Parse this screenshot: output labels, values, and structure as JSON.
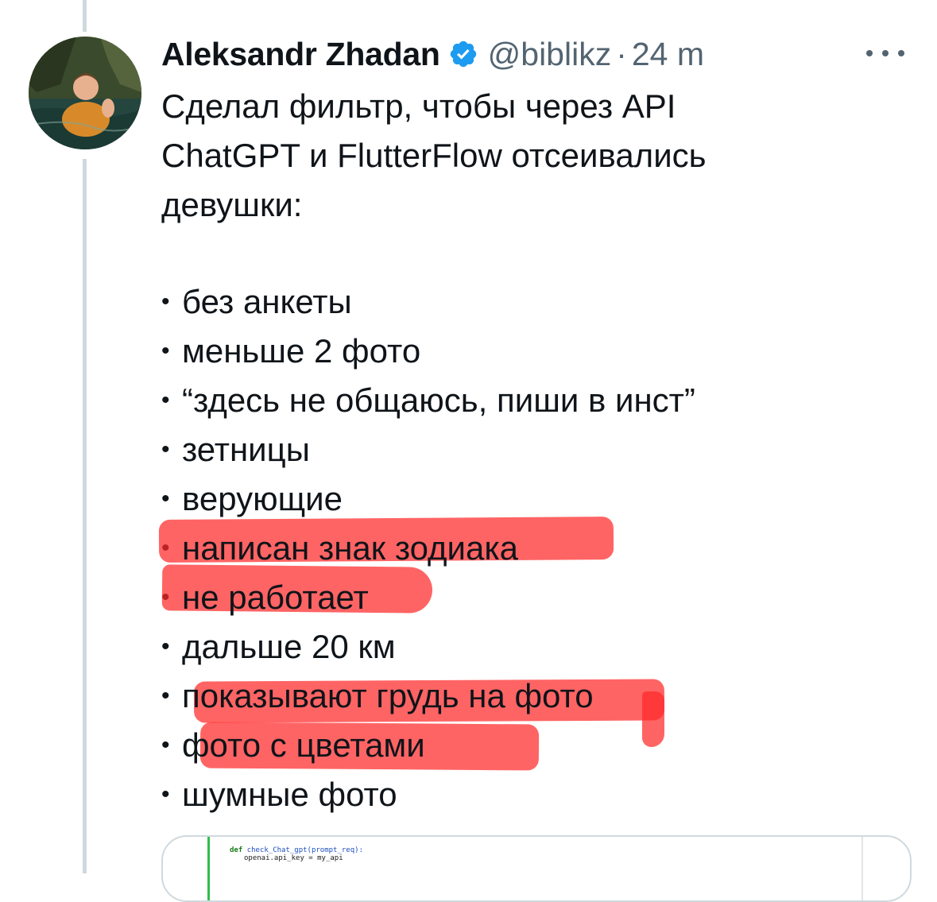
{
  "tweet": {
    "author": {
      "display_name": "Aleksandr Zhadan",
      "handle": "@biblikz",
      "verified": true,
      "avatar_icon": "user-avatar-photo"
    },
    "separator": "·",
    "time": "24 m",
    "more_icon": "more-horizontal-icon",
    "text_lines": [
      "Сделал фильтр, чтобы через API",
      "ChatGPT и FlutterFlow отсеивались",
      "девушки:"
    ],
    "list_items": [
      {
        "bullet": "•",
        "text": "без анкеты",
        "highlighted": false
      },
      {
        "bullet": "•",
        "text": "меньше 2 фото",
        "highlighted": false
      },
      {
        "bullet": "•",
        "text": "“здесь не общаюсь, пиши в инст”",
        "highlighted": false
      },
      {
        "bullet": "•",
        "text": "зетницы",
        "highlighted": false
      },
      {
        "bullet": "•",
        "text": "верующие",
        "highlighted": false
      },
      {
        "bullet": "•",
        "text": "написан знак зодиака",
        "highlighted": true
      },
      {
        "bullet": "•",
        "text": "не работает",
        "highlighted": true
      },
      {
        "bullet": "•",
        "text": "дальше 20 км",
        "highlighted": false
      },
      {
        "bullet": "•",
        "text": "показывают грудь на фото",
        "highlighted": true
      },
      {
        "bullet": "•",
        "text": "фото с цветами",
        "highlighted": true
      },
      {
        "bullet": "•",
        "text": "шумные фото",
        "highlighted": false
      }
    ],
    "media": {
      "code_line_1_keyword": "def",
      "code_line_1_rest": "check_Chat_gpt(prompt_req):",
      "code_line_2": "openai.api_key = my_api"
    }
  },
  "colors": {
    "text_primary": "#0f1419",
    "text_secondary": "#536471",
    "verified_blue": "#1d9bf0",
    "thread_line": "#cfd9de",
    "highlight_red": "#ff2828"
  }
}
